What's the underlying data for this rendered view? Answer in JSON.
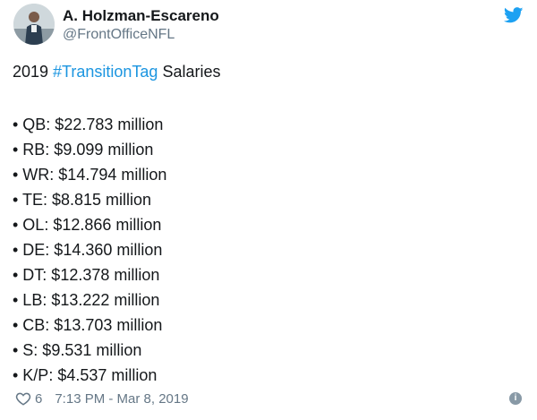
{
  "author": {
    "name": "A. Holzman-Escareno",
    "handle": "@FrontOfficeNFL"
  },
  "tweet": {
    "intro_prefix": "2019 ",
    "hashtag": "#TransitionTag",
    "intro_suffix": " Salaries",
    "salaries": [
      "• QB: $22.783 million",
      "• RB: $9.099 million",
      "• WR: $14.794 million",
      "• TE: $8.815 million",
      "• OL: $12.866 million",
      "• DE: $14.360 million",
      "• DT: $12.378 million",
      "• LB: $13.222 million",
      "• CB: $13.703 million",
      "• S: $9.531 million",
      "• K/P: $4.537 million"
    ]
  },
  "footer": {
    "like_count": "6",
    "timestamp": "7:13 PM - Mar 8, 2019"
  },
  "icons": {
    "brand": "twitter-bird-icon",
    "like": "heart-icon",
    "info": "info-icon"
  },
  "colors": {
    "brand_blue": "#1da1f2",
    "hashtag": "#1b95e0",
    "muted": "#657786"
  }
}
